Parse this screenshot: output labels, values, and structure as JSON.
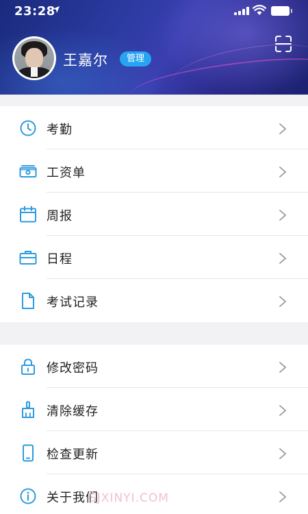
{
  "status_bar": {
    "time": "23:28"
  },
  "profile": {
    "name": "王嘉尔",
    "role_badge": "管理"
  },
  "menu_group_1": [
    {
      "label": "考勤",
      "icon": "clock-icon"
    },
    {
      "label": "工资单",
      "icon": "payslip-icon"
    },
    {
      "label": "周报",
      "icon": "calendar-icon"
    },
    {
      "label": "日程",
      "icon": "briefcase-icon"
    },
    {
      "label": "考试记录",
      "icon": "document-icon"
    }
  ],
  "menu_group_2": [
    {
      "label": "修改密码",
      "icon": "lock-icon"
    },
    {
      "label": "清除缓存",
      "icon": "broom-icon"
    },
    {
      "label": "检查更新",
      "icon": "phone-icon"
    },
    {
      "label": "关于我们",
      "icon": "info-icon"
    }
  ],
  "watermark": "SJXINYI.COM",
  "colors": {
    "accent": "#27a4f2",
    "header_dark": "#1b2270",
    "text": "#222222"
  }
}
